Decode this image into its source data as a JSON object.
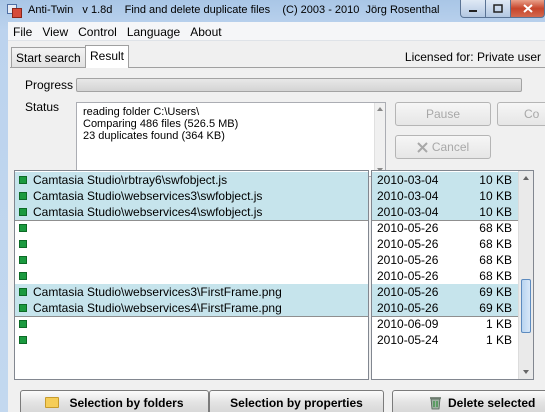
{
  "window": {
    "title": "Anti-Twin   v 1.8d    Find and delete duplicate files    (C) 2003 - 2010  Jörg Rosenthal",
    "accent": "#a9c6e6",
    "close_color": "#c7452b"
  },
  "menu": [
    "File",
    "View",
    "Control",
    "Language",
    "About"
  ],
  "tabs": [
    {
      "label": "Start search",
      "active": false
    },
    {
      "label": "Result",
      "active": true
    }
  ],
  "license": "Licensed for: Private user",
  "progress": {
    "label": "Progress",
    "value": 0
  },
  "status": {
    "label": "Status",
    "lines": [
      "reading folder C:\\Users\\",
      "Comparing 486 files (526.5 MB)",
      "23 duplicates found (364 KB)"
    ]
  },
  "buttons": {
    "pause": "Pause",
    "continue": "Co",
    "cancel": "Cancel"
  },
  "results": [
    {
      "path": "Camtasia Studio\\rbtray6\\swfobject.js",
      "date": "2010-03-04",
      "size": "10 KB",
      "highlight": true
    },
    {
      "path": "Camtasia Studio\\webservices3\\swfobject.js",
      "date": "2010-03-04",
      "size": "10 KB",
      "highlight": true
    },
    {
      "path": "Camtasia Studio\\webservices4\\swfobject.js",
      "date": "2010-03-04",
      "size": "10 KB",
      "highlight": true
    },
    {
      "path": "",
      "date": "2010-05-26",
      "size": "68 KB",
      "highlight": false
    },
    {
      "path": "",
      "date": "2010-05-26",
      "size": "68 KB",
      "highlight": false
    },
    {
      "path": "",
      "date": "2010-05-26",
      "size": "68 KB",
      "highlight": false
    },
    {
      "path": "",
      "date": "2010-05-26",
      "size": "68 KB",
      "highlight": false
    },
    {
      "path": "Camtasia Studio\\webservices3\\FirstFrame.png",
      "date": "2010-05-26",
      "size": "69 KB",
      "highlight": true
    },
    {
      "path": "Camtasia Studio\\webservices4\\FirstFrame.png",
      "date": "2010-05-26",
      "size": "69 KB",
      "highlight": true
    },
    {
      "path": "",
      "date": "2010-06-09",
      "size": "1 KB",
      "highlight": false
    },
    {
      "path": "",
      "date": "2010-05-24",
      "size": "1 KB",
      "highlight": false
    }
  ],
  "bottom_buttons": {
    "by_folders": "Selection by folders",
    "by_properties": "Selection by properties",
    "delete": "Delete selected"
  },
  "icons": {
    "app": "app-icon",
    "folder": "folder-icon",
    "delete": "recycle-bin-icon",
    "cancel": "x-icon"
  }
}
